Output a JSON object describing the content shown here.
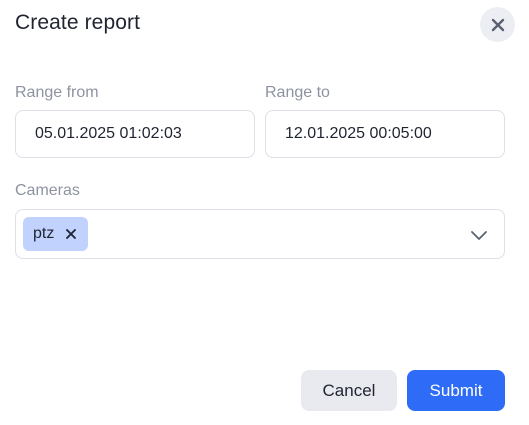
{
  "dialog": {
    "title": "Create report"
  },
  "range_from": {
    "label": "Range from",
    "value": "05.01.2025 01:02:03"
  },
  "range_to": {
    "label": "Range to",
    "value": "12.01.2025 00:05:00"
  },
  "cameras": {
    "label": "Cameras",
    "selected": [
      {
        "label": "ptz"
      }
    ]
  },
  "actions": {
    "cancel_label": "Cancel",
    "submit_label": "Submit"
  },
  "colors": {
    "primary": "#2e6bf6",
    "chip": "#c2d2ff",
    "muted_text": "#8d93a0",
    "border": "#dde0e7",
    "secondary_button": "#e9eaef"
  },
  "icons": {
    "close": "close-icon",
    "chip_remove": "remove-chip-icon",
    "dropdown": "chevron-down-icon"
  }
}
